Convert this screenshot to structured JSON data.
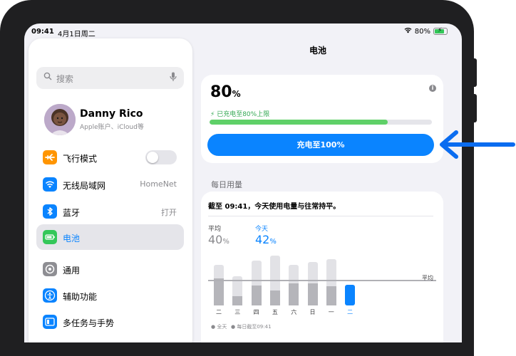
{
  "status_bar": {
    "time": "09:41",
    "date": "4月1日周二",
    "battery_text": "80%",
    "battery_level": 0.8
  },
  "sidebar": {
    "search_placeholder": "搜索",
    "profile": {
      "name": "Danny Rico",
      "subtitle": "Apple账户、iCloud等"
    },
    "items": [
      {
        "label": "飞行模式",
        "value": "",
        "icon": "airplane-icon",
        "color": "#ff9500",
        "toggle": false
      },
      {
        "label": "无线局域网",
        "value": "HomeNet",
        "icon": "wifi-icon",
        "color": "#0a84ff"
      },
      {
        "label": "蓝牙",
        "value": "打开",
        "icon": "bluetooth-icon",
        "color": "#0a84ff"
      },
      {
        "label": "电池",
        "value": "",
        "icon": "battery-icon",
        "color": "#34c759",
        "selected": true
      },
      {
        "label": "通用",
        "value": "",
        "icon": "gear-icon",
        "color": "#8e8e93"
      },
      {
        "label": "辅助功能",
        "value": "",
        "icon": "accessibility-icon",
        "color": "#0a84ff"
      },
      {
        "label": "多任务与手势",
        "value": "",
        "icon": "multitasking-icon",
        "color": "#0a84ff"
      }
    ]
  },
  "main": {
    "title": "电池",
    "battery": {
      "percent": "80",
      "percent_unit": "%",
      "status": "已充电至80%上限",
      "level": 0.8,
      "button": "充电至100%"
    },
    "usage": {
      "section_title": "每日用量",
      "summary": "截至 09:41，今天使用电量与往常持平。",
      "avg_label": "平均",
      "avg_value": "40",
      "avg_unit": "%",
      "today_label": "今天",
      "today_value": "42",
      "today_unit": "%",
      "avg_line_label": "平均",
      "legend": {
        "full": "全天",
        "partial": "每日截至09:41"
      }
    }
  },
  "chart_data": {
    "type": "bar",
    "categories": [
      "二",
      "三",
      "四",
      "五",
      "六",
      "日",
      "一",
      "二"
    ],
    "series": [
      {
        "name": "全天",
        "values": [
          63,
          46,
          70,
          78,
          63,
          68,
          72,
          null
        ]
      },
      {
        "name": "每日截至09:41",
        "values": [
          42,
          15,
          31,
          23,
          35,
          35,
          30,
          32
        ]
      }
    ],
    "average": 40,
    "ylim": [
      0,
      100
    ],
    "colors": {
      "full": "#e2e2e6",
      "partial": "#b5b5ba",
      "today": "#0a84ff"
    }
  },
  "colors": {
    "accent": "#0a84ff",
    "arrow": "#0a6cf0",
    "green": "#34c759"
  }
}
